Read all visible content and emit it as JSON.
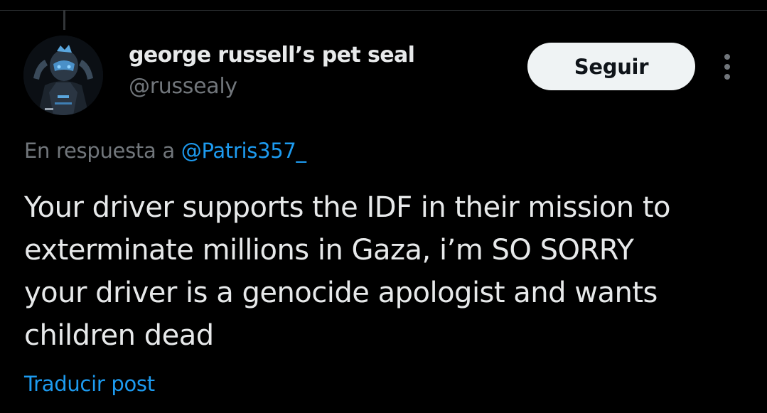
{
  "author": {
    "display_name": "george russell’s pet seal",
    "handle": "@russealy",
    "avatar_icon": "helmeted-figure-avatar"
  },
  "header": {
    "follow_label": "Seguir",
    "more_icon": "more-vertical-icon"
  },
  "reply": {
    "prefix": "En respuesta a",
    "mention": "@Patris357_"
  },
  "tweet": {
    "lines": [
      "Your driver supports the IDF in their mission to",
      "exterminate millions in Gaza, i’m SO SORRY",
      "your driver is a genocide apologist and wants",
      "children dead"
    ]
  },
  "footer": {
    "translate_label": "Traducir post"
  },
  "colors": {
    "background": "#000000",
    "text_primary": "#e7e9ea",
    "text_secondary": "#71767b",
    "link": "#1d9bf0",
    "button_bg": "#eff3f4",
    "button_text": "#0f1419"
  }
}
